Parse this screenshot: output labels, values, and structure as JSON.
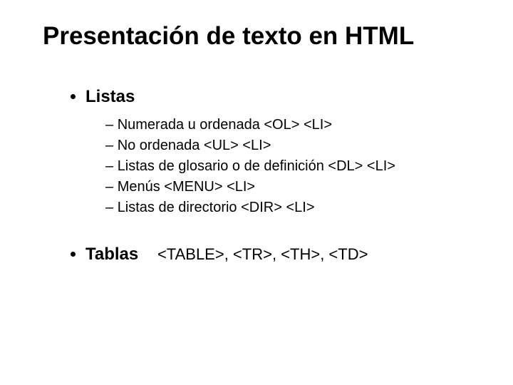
{
  "title": "Presentación de texto en HTML",
  "bullets": {
    "listas": {
      "label": "Listas",
      "items": [
        "Numerada u ordenada   <OL>   <LI>",
        "No ordenada  <UL>  <LI>",
        "Listas de glosario o de definición   <DL> <LI>",
        "Menús    <MENU>  <LI>",
        "Listas de directorio    <DIR>  <LI>"
      ]
    },
    "tablas": {
      "label": "Tablas",
      "tags": "<TABLE>, <TR>, <TH>, <TD>"
    }
  }
}
